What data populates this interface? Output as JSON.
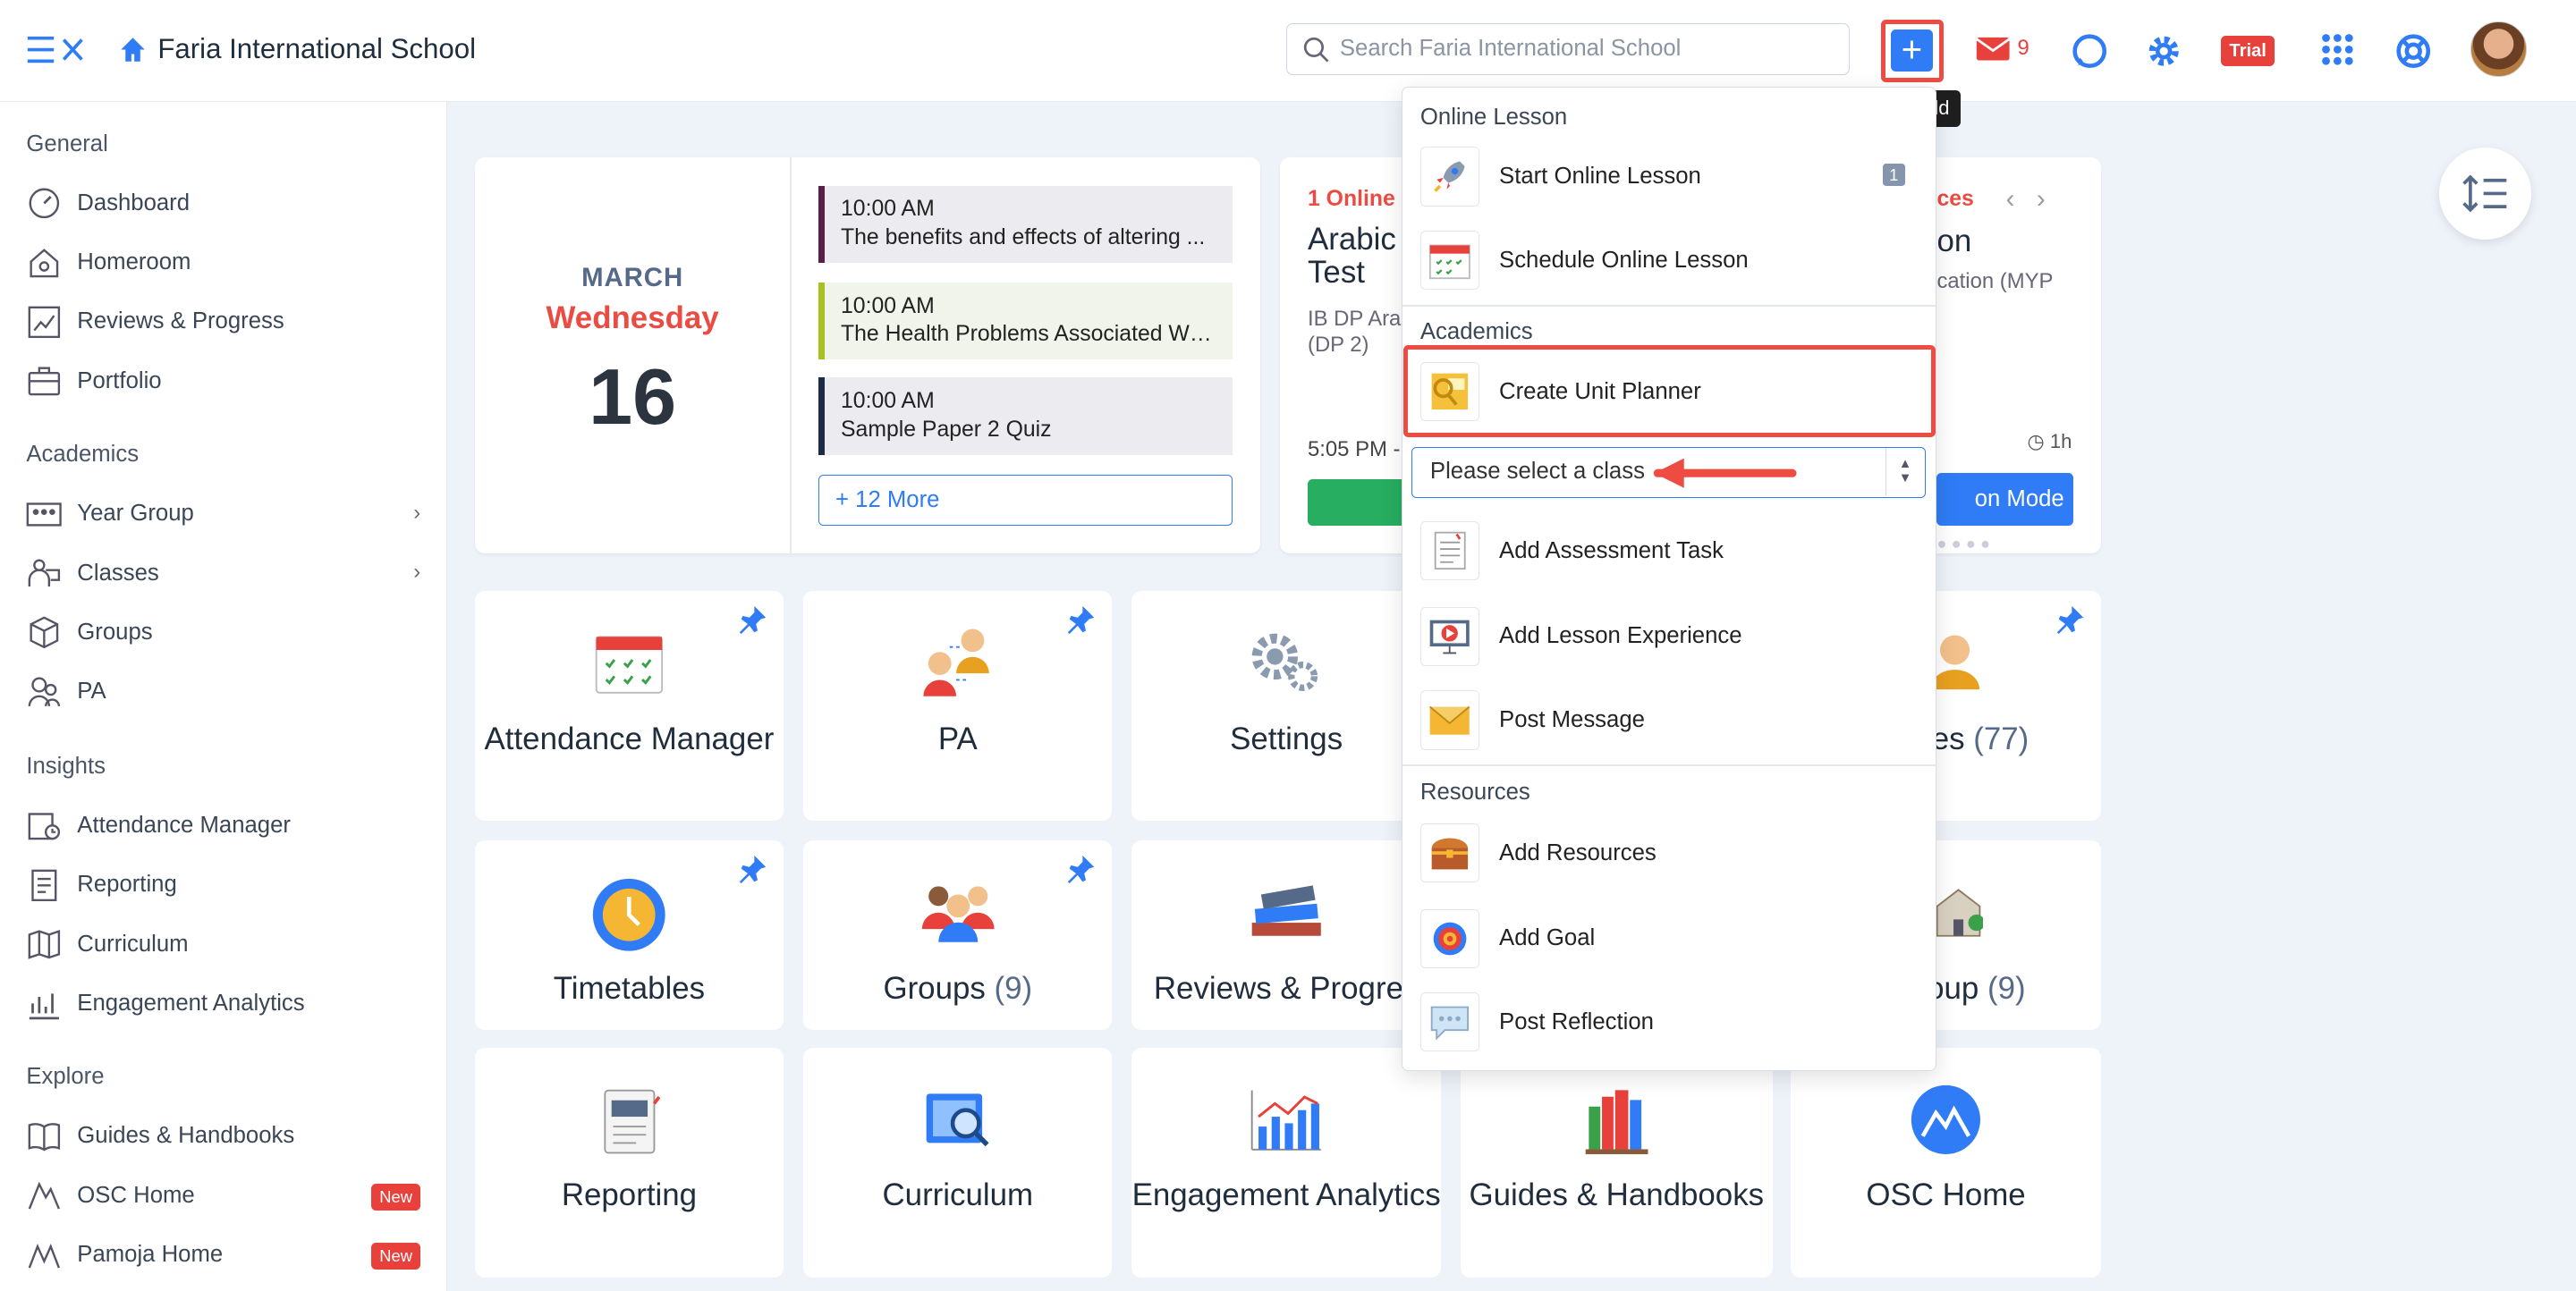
{
  "header": {
    "school_name": "Faria International School",
    "search_placeholder": "Search Faria International School",
    "quick_add_tooltip": "Quick Add",
    "mail_count": "9",
    "trial_label": "Trial"
  },
  "sidebar": {
    "general_heading": "General",
    "general": [
      {
        "label": "Dashboard"
      },
      {
        "label": "Homeroom"
      },
      {
        "label": "Reviews & Progress"
      },
      {
        "label": "Portfolio"
      }
    ],
    "academics_heading": "Academics",
    "academics": [
      {
        "label": "Year Group"
      },
      {
        "label": "Classes"
      },
      {
        "label": "Groups"
      },
      {
        "label": "PA"
      }
    ],
    "insights_heading": "Insights",
    "insights": [
      {
        "label": "Attendance Manager"
      },
      {
        "label": "Reporting"
      },
      {
        "label": "Curriculum"
      },
      {
        "label": "Engagement Analytics"
      }
    ],
    "explore_heading": "Explore",
    "explore": [
      {
        "label": "Guides & Handbooks"
      },
      {
        "label": "OSC Home",
        "badge": "New"
      },
      {
        "label": "Pamoja Home",
        "badge": "New"
      }
    ]
  },
  "calendar": {
    "month": "MARCH",
    "weekday": "Wednesday",
    "day": "16",
    "events": [
      {
        "time": "10:00 AM",
        "title": "The benefits and effects of altering ...",
        "color": "#5a1e4a"
      },
      {
        "time": "10:00 AM",
        "title": "The Health Problems Associated Wit...",
        "color": "#a8c020"
      },
      {
        "time": "10:00 AM",
        "title": "Sample Paper 2 Quiz",
        "color": "#1a2c4a"
      }
    ],
    "more_label": "+ 12 More"
  },
  "lesson_card": {
    "status": "1 Online L",
    "title": "Arabic Test",
    "subtitle": "IB DP Ara (DP 2)",
    "time": "5:05 PM -",
    "status2": "ces",
    "title2": "on",
    "subtitle2": "cation (MYP",
    "duration": "1h",
    "mode_label": "on Mode"
  },
  "tiles": [
    {
      "label": "Attendance Manager"
    },
    {
      "label": "PA"
    },
    {
      "label": "Settings"
    },
    {
      "label": "es",
      "count": "(77)"
    },
    {
      "label": "Timetables"
    },
    {
      "label": "Groups",
      "count": "(9)"
    },
    {
      "label": "Reviews & Progres"
    },
    {
      "label": "roup",
      "count": "(9)"
    },
    {
      "label": "Reporting"
    },
    {
      "label": "Curriculum"
    },
    {
      "label": "Engagement Analytics"
    },
    {
      "label": "Guides & Handbooks"
    },
    {
      "label": "OSC Home"
    }
  ],
  "quick_add": {
    "online_heading": "Online Lesson",
    "start_online": "Start Online Lesson",
    "start_online_count": "1",
    "schedule_online": "Schedule Online Lesson",
    "academics_heading": "Academics",
    "create_unit": "Create Unit Planner",
    "class_select": "Please select a class",
    "assessment": "Add Assessment Task",
    "lesson_exp": "Add Lesson Experience",
    "post_message": "Post Message",
    "resources_heading": "Resources",
    "add_resources": "Add Resources",
    "add_goal": "Add Goal",
    "post_reflection": "Post Reflection"
  }
}
